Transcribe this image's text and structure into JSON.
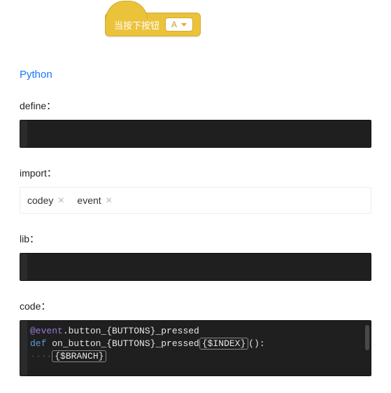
{
  "block": {
    "label": "当按下按钮",
    "dropdown_value": "A"
  },
  "language_tab": "Python",
  "labels": {
    "define": "define：",
    "import": "import：",
    "lib": "lib：",
    "code": "code："
  },
  "import_tags": [
    "codey",
    "event"
  ],
  "code": {
    "decorator_prefix": "@event",
    "decorator_rest": ".button_{BUTTONS}_pressed",
    "def_kw": "def",
    "fn_part1": "on_button_{BUTTONS}_pressed",
    "fn_index_placeholder": "{$INDEX}",
    "fn_part2": "():",
    "indent_dots": "····",
    "branch_placeholder": "{$BRANCH}"
  }
}
